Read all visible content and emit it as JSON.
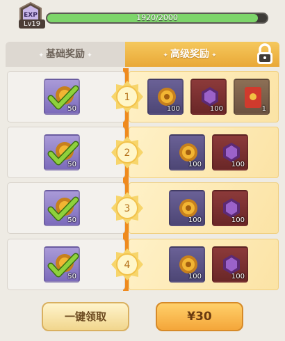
{
  "exp": {
    "badge_label": "EXP",
    "level": "Lv19",
    "progress_text": "1920/2000",
    "progress_fraction": 0.96
  },
  "tabs": {
    "basic_label": "基础奖励",
    "premium_label": "高级奖励",
    "premium_locked": true
  },
  "rows": [
    {
      "level": "1",
      "basic": {
        "item": "gold-coin-claimed",
        "qty": "50",
        "claimed": true
      },
      "premium": [
        {
          "item": "gold-coin",
          "qty": "100"
        },
        {
          "item": "purple-gem",
          "qty": "100"
        },
        {
          "item": "red-envelope",
          "qty": "1"
        }
      ]
    },
    {
      "level": "2",
      "basic": {
        "item": "gold-coin-claimed",
        "qty": "50",
        "claimed": true
      },
      "premium": [
        {
          "item": "gold-coin",
          "qty": "100"
        },
        {
          "item": "purple-gem",
          "qty": "100"
        }
      ]
    },
    {
      "level": "3",
      "basic": {
        "item": "gold-coin-claimed",
        "qty": "50",
        "claimed": true
      },
      "premium": [
        {
          "item": "gold-coin",
          "qty": "100"
        },
        {
          "item": "purple-gem",
          "qty": "100"
        }
      ]
    },
    {
      "level": "4",
      "basic": {
        "item": "gold-coin-claimed",
        "qty": "50",
        "claimed": true
      },
      "premium": [
        {
          "item": "gold-coin",
          "qty": "100"
        },
        {
          "item": "purple-gem",
          "qty": "100"
        }
      ]
    }
  ],
  "buttons": {
    "claim_all_label": "一键领取",
    "buy_label": "¥30"
  },
  "colors": {
    "premium_accent": "#f0b441",
    "progress_fill": "#7dd56a",
    "check_green": "#8ed13c",
    "stripe": "#ef8a1e"
  }
}
